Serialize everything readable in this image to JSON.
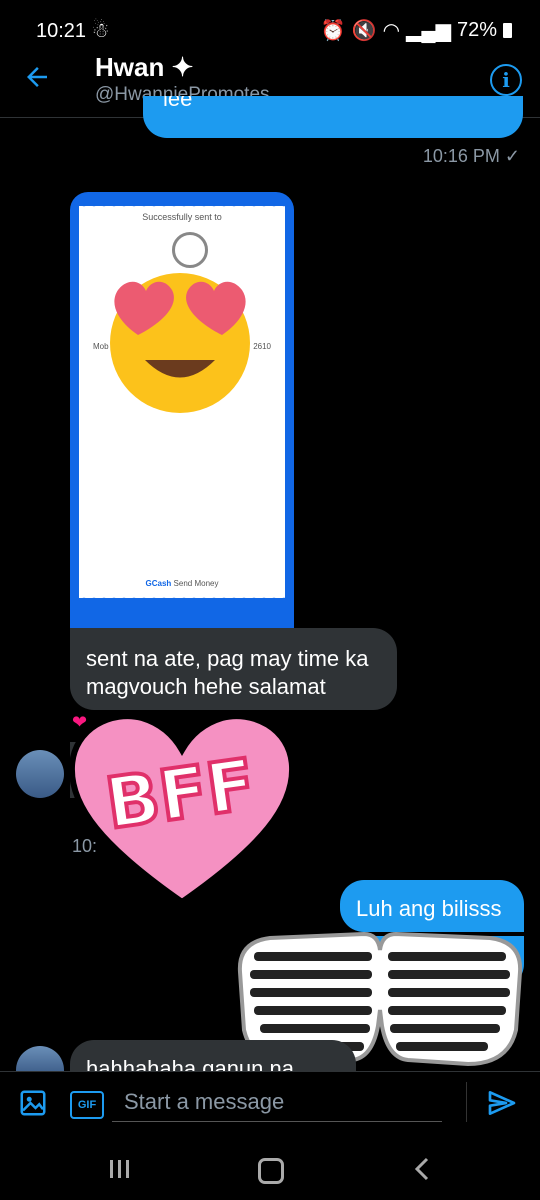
{
  "status": {
    "time": "10:21",
    "battery": "72%"
  },
  "header": {
    "name": "Hwan ✦",
    "handle": "@HwanniePromotes",
    "info": "i"
  },
  "messages": {
    "partial_out": "lee",
    "ts1": "10:16 PM ✓",
    "receipt": {
      "title": "Successfully sent to",
      "left": "Mob",
      "right": "2610",
      "footer_brand": "GCash",
      "footer_text": " Send Money"
    },
    "msg_in1_l1": "sent na ate, pag may time ka",
    "msg_in1_l2": "magvouch hehe salamat",
    "ts2": "10:",
    "msg_out2": "Luh ang bilisss",
    "msg_in3": "hahhahaha ganun na"
  },
  "stickers": {
    "bff": "BFF"
  },
  "composer": {
    "placeholder": "Start a message",
    "gif": "GIF"
  }
}
